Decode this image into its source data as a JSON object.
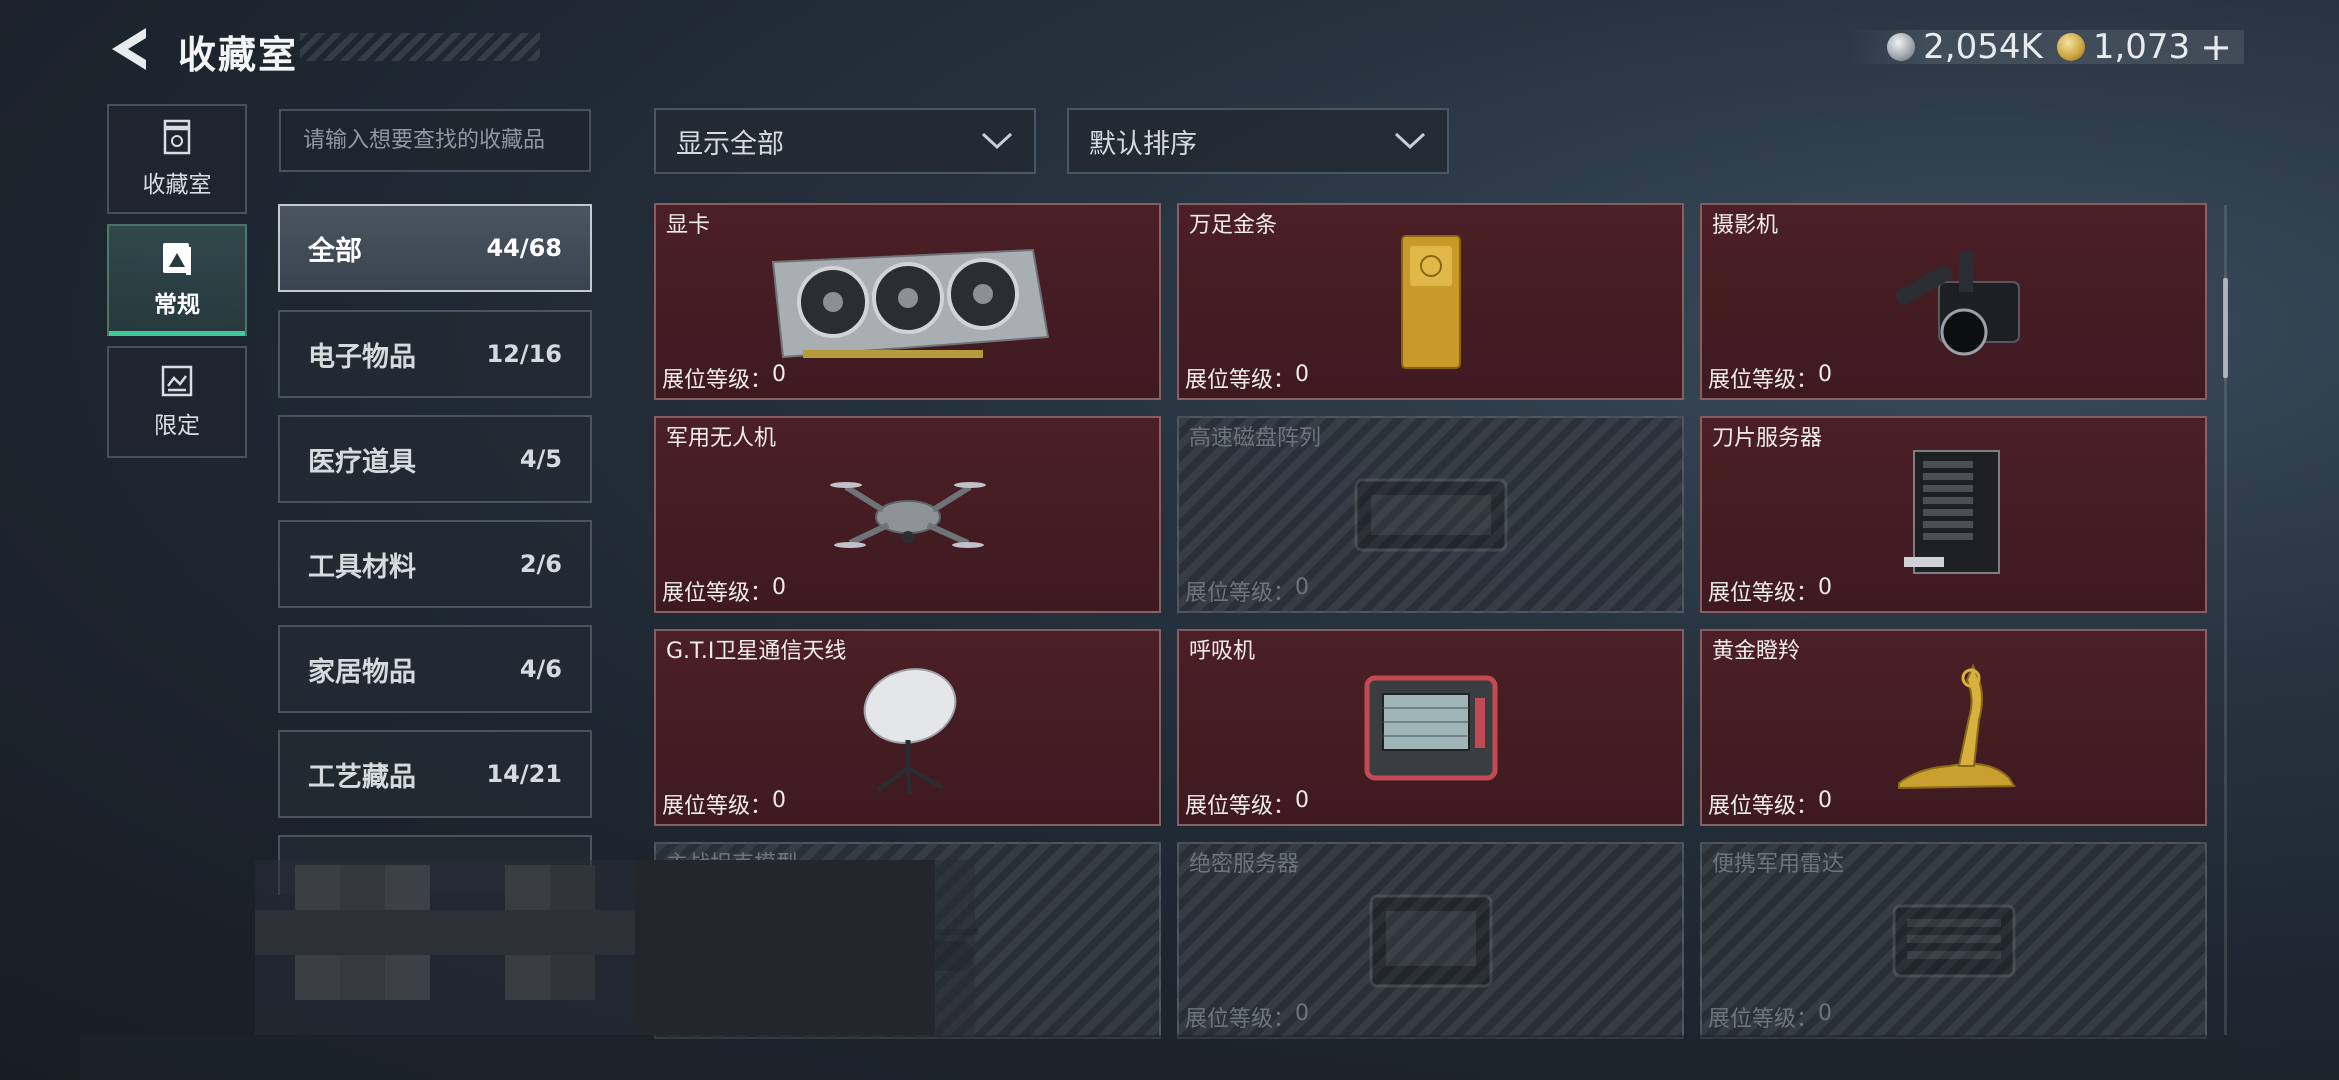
{
  "header": {
    "title": "收藏室"
  },
  "currency": [
    {
      "icon": "silver-coin-icon",
      "value": "2,054K"
    },
    {
      "icon": "gold-coin-icon",
      "value": "1,073"
    }
  ],
  "currency_add": "+",
  "side_tabs": [
    {
      "label": "收藏室",
      "icon": "showcase-icon"
    },
    {
      "label": "常规",
      "icon": "standard-collection-icon",
      "active": true
    },
    {
      "label": "限定",
      "icon": "limited-collection-icon"
    }
  ],
  "search": {
    "placeholder": "请输入想要查找的收藏品"
  },
  "categories": [
    {
      "name": "全部",
      "count": "44/68",
      "active": true
    },
    {
      "name": "电子物品",
      "count": "12/16"
    },
    {
      "name": "医疗道具",
      "count": "4/5"
    },
    {
      "name": "工具材料",
      "count": "2/6"
    },
    {
      "name": "家居物品",
      "count": "4/6"
    },
    {
      "name": "工艺藏品",
      "count": "14/21"
    }
  ],
  "filters": {
    "display": "显示全部",
    "sort": "默认排序"
  },
  "level_label": "展位等级：",
  "items": [
    {
      "name": "显卡",
      "level": "0",
      "icon": "graphics-card-icon",
      "unlocked": true
    },
    {
      "name": "万足金条",
      "level": "0",
      "icon": "gold-bar-icon",
      "unlocked": true
    },
    {
      "name": "摄影机",
      "level": "0",
      "icon": "film-camera-icon",
      "unlocked": true
    },
    {
      "name": "军用无人机",
      "level": "0",
      "icon": "drone-icon",
      "unlocked": true
    },
    {
      "name": "高速磁盘阵列",
      "level": "0",
      "icon": "disk-array-icon",
      "unlocked": false
    },
    {
      "name": "刀片服务器",
      "level": "0",
      "icon": "blade-server-icon",
      "unlocked": true
    },
    {
      "name": "G.T.I卫星通信天线",
      "level": "0",
      "icon": "satellite-dish-icon",
      "unlocked": true
    },
    {
      "name": "呼吸机",
      "level": "0",
      "icon": "ventilator-icon",
      "unlocked": true
    },
    {
      "name": "黄金瞪羚",
      "level": "0",
      "icon": "golden-gazelle-icon",
      "unlocked": true
    },
    {
      "name": "主战坦克模型",
      "level": "",
      "icon": "tank-model-icon",
      "unlocked": false
    },
    {
      "name": "绝密服务器",
      "level": "0",
      "icon": "secret-server-icon",
      "unlocked": false
    },
    {
      "name": "便携军用雷达",
      "level": "0",
      "icon": "portable-radar-icon",
      "unlocked": false
    }
  ]
}
